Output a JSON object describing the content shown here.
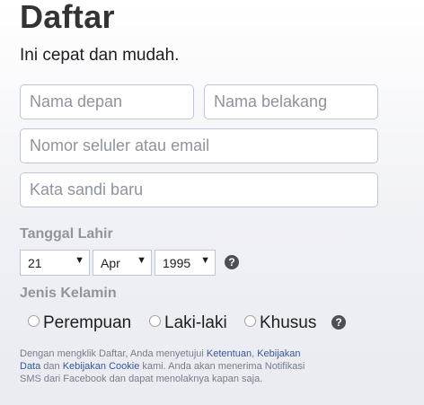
{
  "header": {
    "title": "Daftar",
    "subtitle": "Ini cepat dan mudah."
  },
  "form": {
    "first_name_placeholder": "Nama depan",
    "last_name_placeholder": "Nama belakang",
    "contact_placeholder": "Nomor seluler atau email",
    "password_placeholder": "Kata sandi baru"
  },
  "birthday": {
    "label": "Tanggal Lahir",
    "day": "21",
    "month": "Apr",
    "year": "1995",
    "help_icon": "question-circle-icon",
    "help_symbol": "?",
    "dropdown_arrow": "▼"
  },
  "gender": {
    "label": "Jenis Kelamin",
    "options": [
      "Perempuan",
      "Laki-laki",
      "Khusus"
    ],
    "help_symbol": "?"
  },
  "terms": {
    "part1": "Dengan mengklik Daftar, Anda menyetujui ",
    "link_terms": "Ketentuan",
    "sep1": ", ",
    "link_data_policy": "Kebijakan Data",
    "part2": " dan ",
    "link_cookie_policy": "Kebijakan Cookie",
    "part3": " kami. Anda akan menerima Notifikasi SMS dari Facebook dan dapat menolaknya kapan saja."
  },
  "colors": {
    "link": "#365899",
    "muted_label": "#90949c",
    "title": "#333333",
    "input_border": "#bdc7d8"
  }
}
